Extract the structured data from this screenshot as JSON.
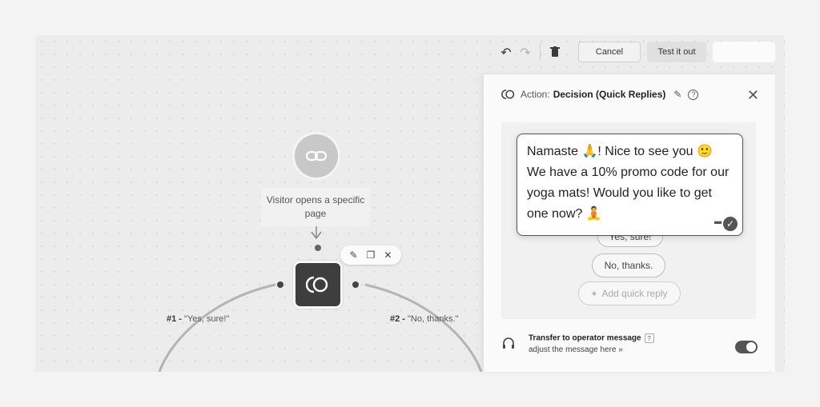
{
  "toolbar": {
    "undo_icon": "undo-icon",
    "redo_icon": "redo-icon",
    "delete_icon": "trash-icon",
    "cancel_label": "Cancel",
    "test_label": "Test it out"
  },
  "flow": {
    "trigger_label": "Visitor opens a specific page",
    "branches": [
      {
        "number": "#1 -",
        "label": "\"Yes, sure!\""
      },
      {
        "number": "#2 -",
        "label": "\"No, thanks.\""
      }
    ]
  },
  "panel": {
    "action_label": "Action:",
    "action_title": "Decision (Quick Replies)",
    "message_text": "Namaste 🙏! Nice to see you 🙂 We have a 10% promo code for our yoga mats! Would you like to get one now? 🧘",
    "quick_replies": [
      "Yes, sure!",
      "No, thanks."
    ],
    "add_quick_reply_label": "Add quick reply",
    "transfer": {
      "title": "Transfer to operator message",
      "help": "?",
      "subtitle": "adjust the message here »",
      "enabled": true
    }
  },
  "colors": {
    "canvas": "#ececec",
    "node_dark": "#3e3e3e",
    "node_light": "#c8c8c8",
    "panel": "#fafafa"
  }
}
